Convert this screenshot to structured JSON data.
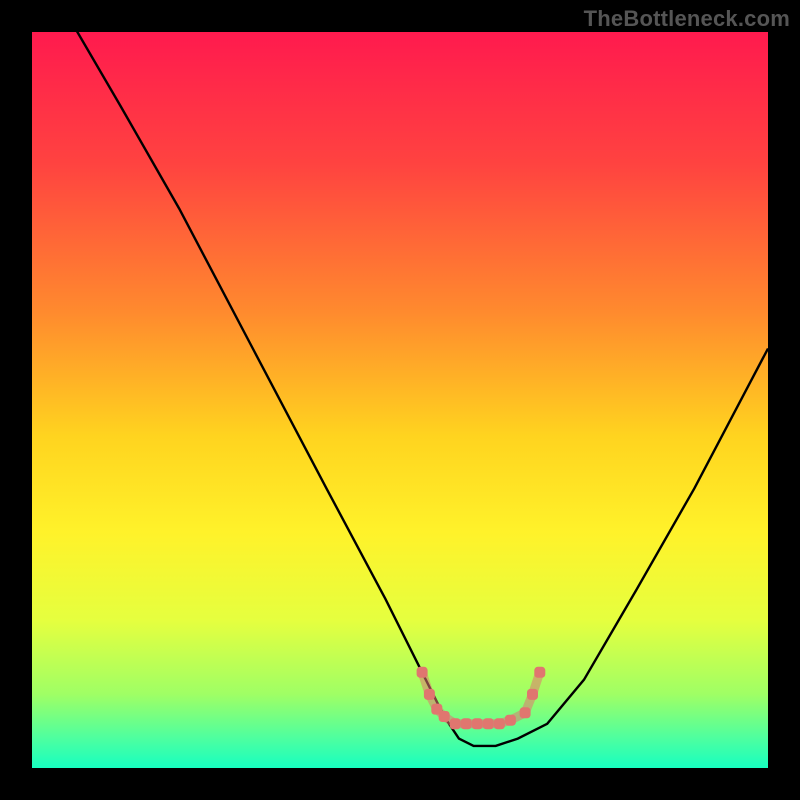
{
  "watermark": "TheBottleneck.com",
  "chart_data": {
    "type": "line",
    "title": "",
    "xlabel": "",
    "ylabel": "",
    "xlim": [
      0,
      100
    ],
    "ylim": [
      0,
      100
    ],
    "grid": false,
    "legend": false,
    "series": [
      {
        "name": "bottleneck-curve",
        "x": [
          0,
          5,
          12,
          20,
          30,
          40,
          48,
          53,
          56,
          58,
          60,
          63,
          66,
          70,
          75,
          82,
          90,
          100
        ],
        "y": [
          110,
          102,
          90,
          76,
          57,
          38,
          23,
          13,
          7,
          4,
          3,
          3,
          4,
          6,
          12,
          24,
          38,
          57
        ]
      }
    ],
    "highlight": {
      "name": "optimal-range",
      "color": "#e0766f",
      "points": [
        {
          "x": 53,
          "y": 13
        },
        {
          "x": 54,
          "y": 10
        },
        {
          "x": 55,
          "y": 8
        },
        {
          "x": 56,
          "y": 7
        },
        {
          "x": 57.5,
          "y": 6
        },
        {
          "x": 59,
          "y": 6
        },
        {
          "x": 60.5,
          "y": 6
        },
        {
          "x": 62,
          "y": 6
        },
        {
          "x": 63.5,
          "y": 6
        },
        {
          "x": 65,
          "y": 6.5
        },
        {
          "x": 67,
          "y": 7.5
        },
        {
          "x": 68,
          "y": 10
        },
        {
          "x": 69,
          "y": 13
        }
      ]
    },
    "background": {
      "type": "gradient-vertical",
      "stops": [
        {
          "pos": 0.0,
          "color": "#ff1a4e"
        },
        {
          "pos": 0.18,
          "color": "#ff4340"
        },
        {
          "pos": 0.38,
          "color": "#ff8a2e"
        },
        {
          "pos": 0.55,
          "color": "#ffd41f"
        },
        {
          "pos": 0.68,
          "color": "#fff22a"
        },
        {
          "pos": 0.8,
          "color": "#e5ff3f"
        },
        {
          "pos": 0.9,
          "color": "#9fff65"
        },
        {
          "pos": 0.96,
          "color": "#4dffa0"
        },
        {
          "pos": 1.0,
          "color": "#17ffc0"
        }
      ]
    }
  }
}
